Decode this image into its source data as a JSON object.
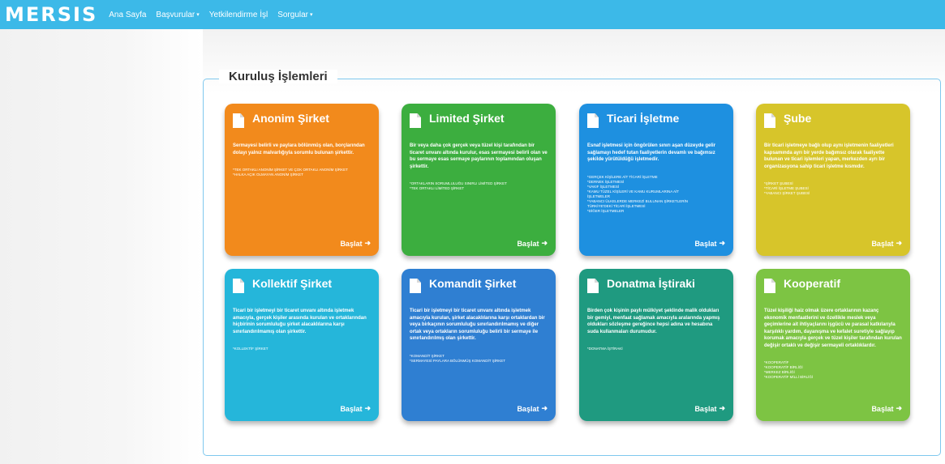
{
  "navbar": {
    "brand": "MERSIS",
    "items": [
      {
        "label": "Ana Sayfa",
        "caret": ""
      },
      {
        "label": "Başvurular",
        "caret": "▾"
      },
      {
        "label": "Yetkilendirme İşl",
        "caret": ""
      },
      {
        "label": "Sorgular",
        "caret": "▾"
      }
    ]
  },
  "panel": {
    "title": "Kuruluş İşlemleri"
  },
  "cards": [
    {
      "title": "Anonim Şirket",
      "color": "#f28a1c",
      "button": "Başlat",
      "description": "Sermayesi belirli ve paylara bölünmüş olan, borçlarından dolayı yalnız malvarlığıyla sorumlu bulunan şirkettir.",
      "items": [
        "*TEK ORTAKLI ANONİM ŞİRKET VE ÇOK ORTAKLI ANONİM ŞİRKET",
        "*HALKA AÇIK OLMAYAN ANONİM ŞİRKET"
      ]
    },
    {
      "title": "Limited Şirket",
      "color": "#3cae3f",
      "button": "Başlat",
      "description": "Bir veya daha çok gerçek veya tüzel kişi tarafından bir ticaret unvanı altında kurulur, esas sermayesi belirli olan ve bu sermaye esas sermaye paylarının toplamından oluşan şirkettir.",
      "items": [
        "*ORTAKLARIN SORUMLULUĞU SINIRLI LİMİTED ŞİRKET",
        "*TEK ORTAKLI LİMİTED ŞİRKET"
      ]
    },
    {
      "title": "Ticari İşletme",
      "color": "#1e90e0",
      "button": "Başlat",
      "description": "Esnaf işletmesi için öngörülen sınırı aşan düzeyde gelir sağlamayı hedef tutan faaliyetlerin devamlı ve bağımsız şekilde yürütüldüğü işletmedir.",
      "items": [
        "*GERÇEK KİŞİLERE AİT TİCARİ İŞLETME",
        "*DERNEK İŞLETMESİ",
        "*VAKIF İŞLETMESİ",
        "*KAMU TÜZEL KİŞİLERİ VE KAMU KURUMLARINA AİT",
        "İŞLETMELER",
        "*YABANCI ÜLKELERDE MERKEZİ BULUNAN ŞİRKETLERİN",
        "TÜRKİYE'DEKİ TİCARİ İŞLETMESİ",
        "*DİĞER İŞLETMELER"
      ]
    },
    {
      "title": "Şube",
      "color": "#d7c52a",
      "button": "Başlat",
      "description": "Bir ticari işletmeye bağlı olup aynı işletmenin faaliyetleri kapsamında ayrı bir yerde bağımsız olarak faaliyette bulunan ve ticari işlemleri yapan, merkezden ayrı bir organizasyona sahip ticari işletme kısmıdır.",
      "items": [
        "*ŞİRKET ŞUBESİ",
        "*TİCARİ İŞLETME ŞUBESİ",
        "*YABANCI ŞİRKET ŞUBESİ"
      ]
    },
    {
      "title": "Kollektif Şirket",
      "color": "#25b6da",
      "button": "Başlat",
      "description": "Ticari bir işletmeyi bir ticaret unvanı altında işletmek amacıyla, gerçek kişiler arasında kurulan ve ortaklarından hiçbirinin sorumluluğu şirket alacaklılarına karşı sınırlandırılmamış olan şirkettir.",
      "items": [
        "*KOLLEKTİF ŞİRKET"
      ]
    },
    {
      "title": "Komandit Şirket",
      "color": "#2f7fd2",
      "button": "Başlat",
      "description": "Ticari bir işletmeyi bir ticaret unvanı altında işletmek amacıyla kurulan, şirket alacaklılarına karşı ortaklardan bir veya birkaçının sorumluluğu sınırlandırılmamış ve diğer ortak veya ortakların sorumluluğu belirli bir sermaye ile sınırlandırılmış olan şirkettir.",
      "items": [
        "*KOMANDİT ŞİRKET",
        "*SERMAYESİ PAYLARA BÖLÜNMÜŞ KOMANDİT ŞİRKET"
      ]
    },
    {
      "title": "Donatma İştiraki",
      "color": "#1f9a80",
      "button": "Başlat",
      "description": "Birden çok kişinin paylı mülkiyet şeklinde malik oldukları bir gemiyi, menfaat sağlamak amacıyla aralarında yapmış oldukları sözleşme gereğince hepsi adına ve hesabına suda kullanmaları durumudur.",
      "items": [
        "*DONATMA İŞTİRAKİ"
      ]
    },
    {
      "title": "Kooperatif",
      "color": "#7dc443",
      "button": "Başlat",
      "description": "Tüzel kişiliği haiz olmak üzere ortaklarının kazanç ekonomik menfaatlerini ve özellikle meslek veya geçimlerine ait ihtiyaçlarını işgücü ve parasal katkılarıyla karşılıklı yardım, dayanışma ve kefalet suretiyle sağlayıp korumak amacıyla gerçek ve tüzel kişiler tarafından kurulan değişir ortaklı ve değişir sermayeli ortaklıklardır.",
      "items": [
        "*KOOPERATİF",
        "*KOOPERATİF BİRLİĞİ",
        "*MERKEZ BİRLİĞİ",
        "*KOOPERATİF MİLLİ BİRLİĞİ"
      ]
    }
  ]
}
